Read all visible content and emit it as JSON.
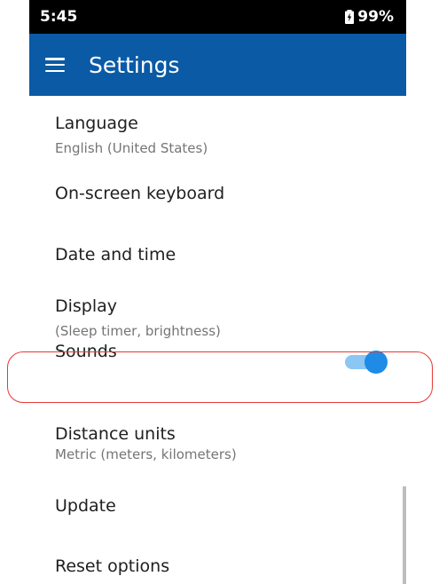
{
  "status_bar": {
    "time": "5:45",
    "battery": "99%"
  },
  "app_bar": {
    "title": "Settings",
    "menu_icon": "hamburger-menu-icon"
  },
  "settings": [
    {
      "label": "Language",
      "sub": "English (United States)"
    },
    {
      "label": "On-screen keyboard"
    },
    {
      "label": "Date and time"
    },
    {
      "label": "Display",
      "sub": "(Sleep timer, brightness)"
    },
    {
      "label": "Sounds",
      "toggle_on": true
    },
    {
      "label": "Distance units",
      "sub": "Metric (meters, kilometers)"
    },
    {
      "label": "Update"
    },
    {
      "label": "Reset options"
    }
  ],
  "colors": {
    "app_bar": "#0a5aa6",
    "toggle_thumb": "#1e8ce6",
    "toggle_track": "#8cc6f2",
    "highlight": "#e53935"
  }
}
